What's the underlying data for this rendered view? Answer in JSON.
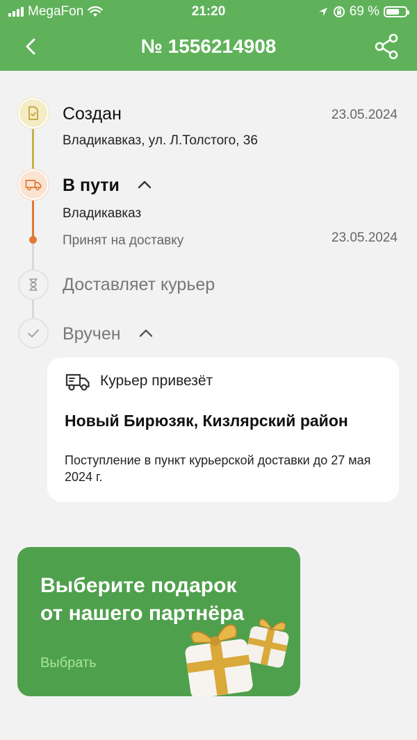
{
  "status_bar": {
    "carrier": "MegaFon",
    "time": "21:20",
    "battery": "69 %",
    "battery_level": 0.69
  },
  "header": {
    "title": "№ 1556214908",
    "back_icon": "chevron-left-icon",
    "share_icon": "share-icon"
  },
  "timeline": [
    {
      "title": "Создан",
      "subtitle": "Владикавказ, ул. Л.Толстого, 36",
      "date": "23.05.2024",
      "icon": "document-check-icon"
    },
    {
      "title": "В пути",
      "location": "Владикавказ",
      "event": "Принят на доставку",
      "date": "23.05.2024",
      "icon": "truck-icon"
    },
    {
      "title": "Доставляет курьер",
      "icon": "hourglass-icon"
    },
    {
      "title": "Вручен",
      "icon": "check-icon"
    }
  ],
  "courier_card": {
    "title": "Курьер привезёт",
    "address": "Новый Бирюзяк, Кизлярский район",
    "info": "Поступление в пункт курьерской доставки до 27 мая 2024 г."
  },
  "promo": {
    "title": "Выберите подарок\nот нашего партнёра",
    "link": "Выбрать"
  },
  "colors": {
    "header": "#5fb25a",
    "promo": "#4fa04d",
    "created": "#c6b14a",
    "in_transit": "#e07a33"
  }
}
